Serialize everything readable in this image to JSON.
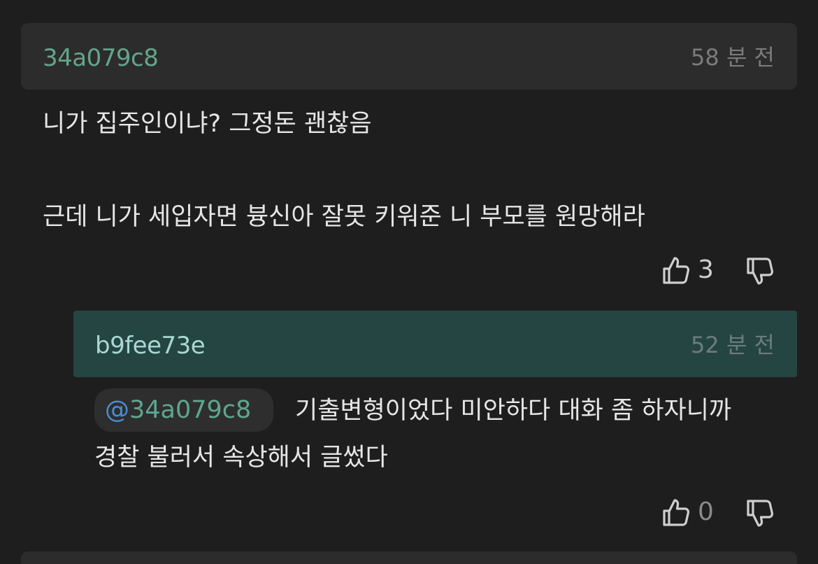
{
  "comment": {
    "author": "34a079c8",
    "time": "58 분 전",
    "line1": "니가 집주인이냐? 그정돈 괜찮음",
    "line2": "근데 니가 세입자면 븅신아 잘못 키워준 니 부모를 원망해라",
    "likes": "3",
    "like_icon": "thumbs-up-icon",
    "dislike_icon": "thumbs-down-icon"
  },
  "reply": {
    "author": "b9fee73e",
    "time": "52 분 전",
    "mention_at": "@",
    "mention_name": "34a079c8",
    "line1": "기출변형이었다 미안하다 대화 좀 하자니까",
    "line2": "경찰 불러서 속상해서 글썼다",
    "likes": "0"
  },
  "colors": {
    "background": "#1e1e1e",
    "header_bg": "#2c2c2c",
    "reply_header_bg": "#254543",
    "author_green": "#63a58c",
    "mention_blue": "#4a8ed6"
  }
}
